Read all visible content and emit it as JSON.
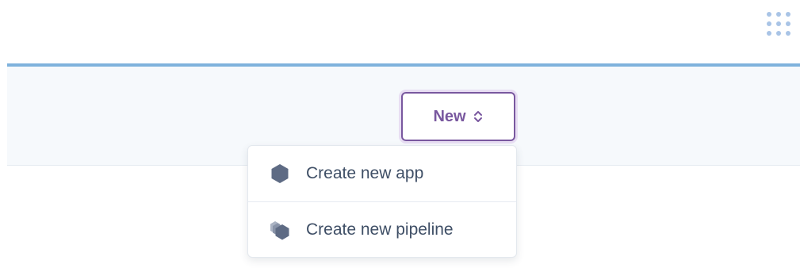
{
  "header": {
    "apps_icon": "apps-grid-icon"
  },
  "colors": {
    "accent_line": "#7fb2dc",
    "primary_purple": "#79589f",
    "toolbar_bg": "#f6f9fc",
    "menu_text": "#3f4f66",
    "icon_gray": "#5e6b84"
  },
  "toolbar": {
    "new_button": {
      "label": "New",
      "icon": "up-down-chevron-icon"
    }
  },
  "dropdown": {
    "items": [
      {
        "label": "Create new app",
        "icon": "hexagon-app-icon"
      },
      {
        "label": "Create new pipeline",
        "icon": "stacked-hexagons-pipeline-icon"
      }
    ]
  }
}
